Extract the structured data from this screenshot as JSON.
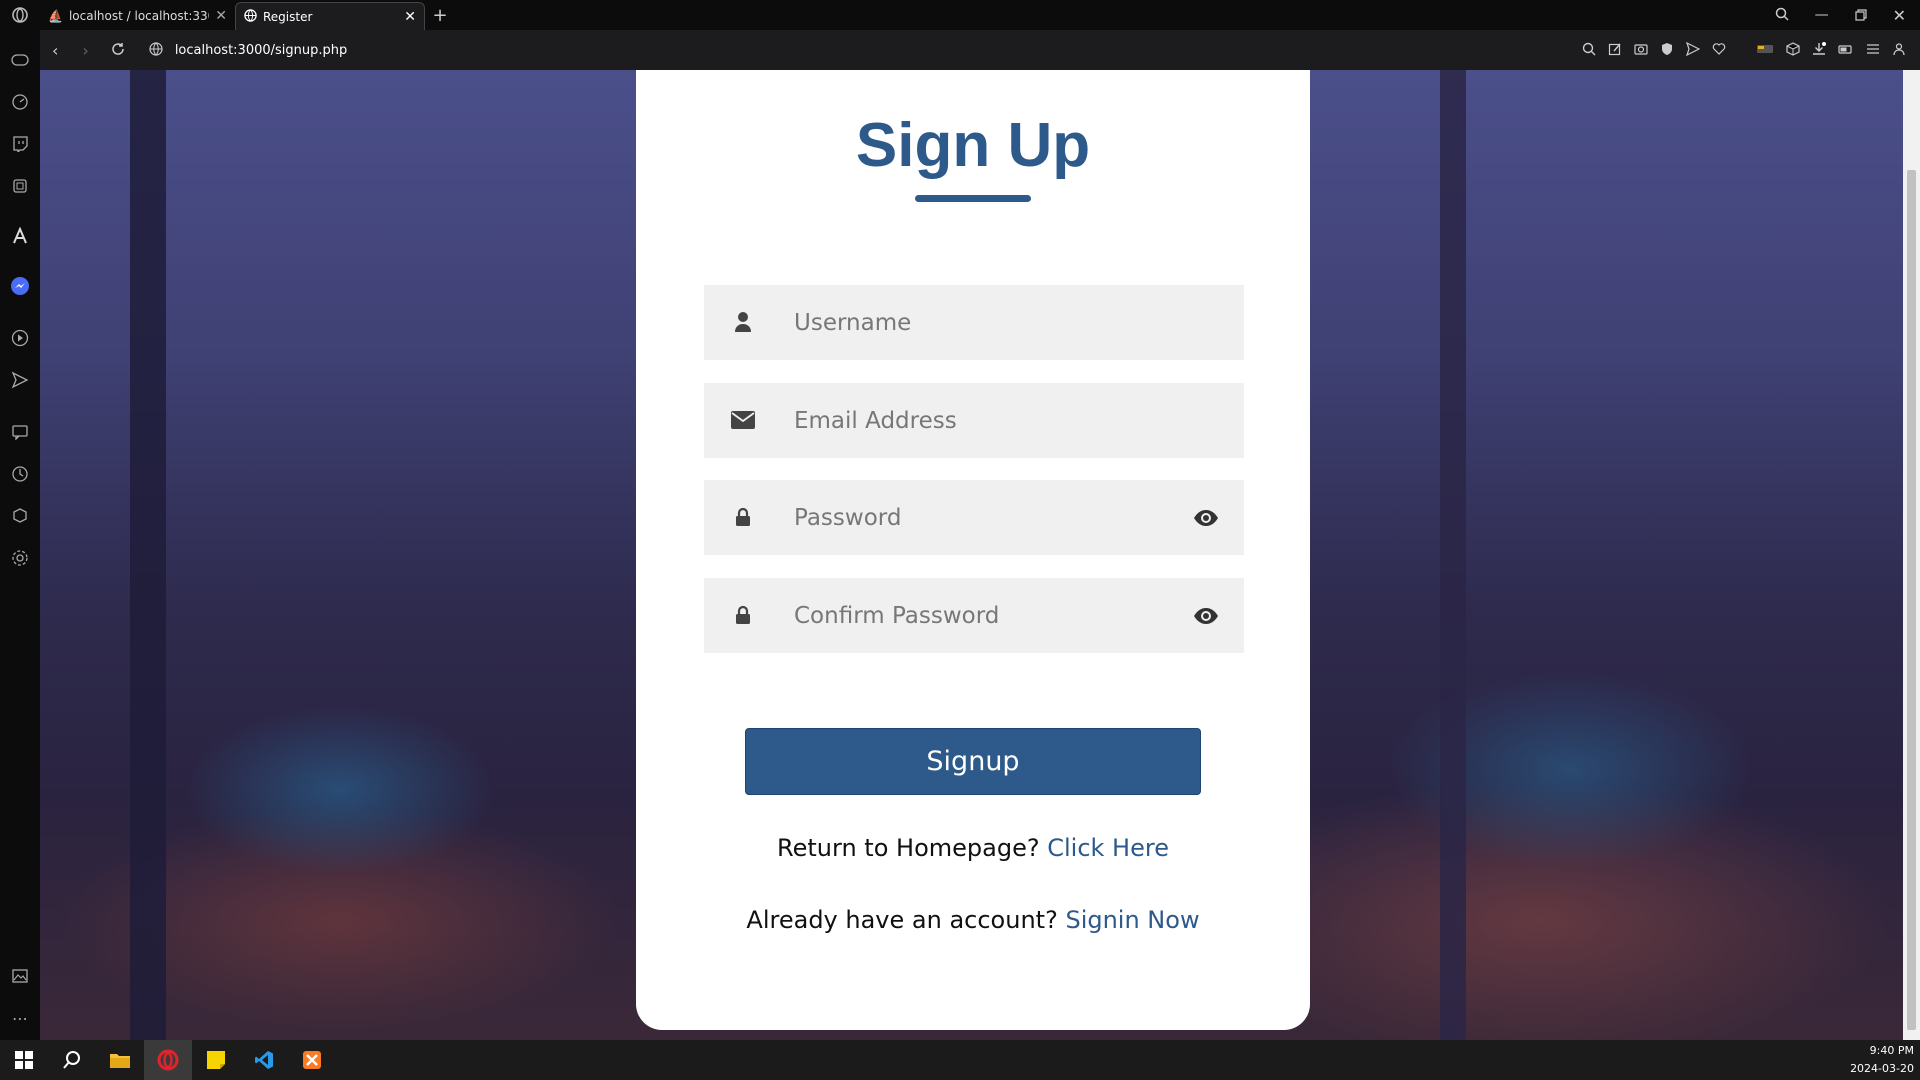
{
  "browser": {
    "tabs": [
      {
        "label": "localhost / localhost:3307 /",
        "active": false
      },
      {
        "label": "Register",
        "active": true
      }
    ],
    "url": "localhost:3000/signup.php"
  },
  "form": {
    "title": "Sign Up",
    "username_placeholder": "Username",
    "email_placeholder": "Email Address",
    "password_placeholder": "Password",
    "confirm_placeholder": "Confirm Password",
    "submit_label": "Signup",
    "homepage_text": "Return to Homepage?",
    "homepage_link": "Click Here",
    "account_text": "Already have an account?",
    "account_link": "Signin Now"
  },
  "taskbar": {
    "time": "9:40 PM",
    "date": "2024-03-20"
  },
  "colors": {
    "accent": "#2d5a8a",
    "card": "#ffffff",
    "field_bg": "#f0f0f0"
  }
}
